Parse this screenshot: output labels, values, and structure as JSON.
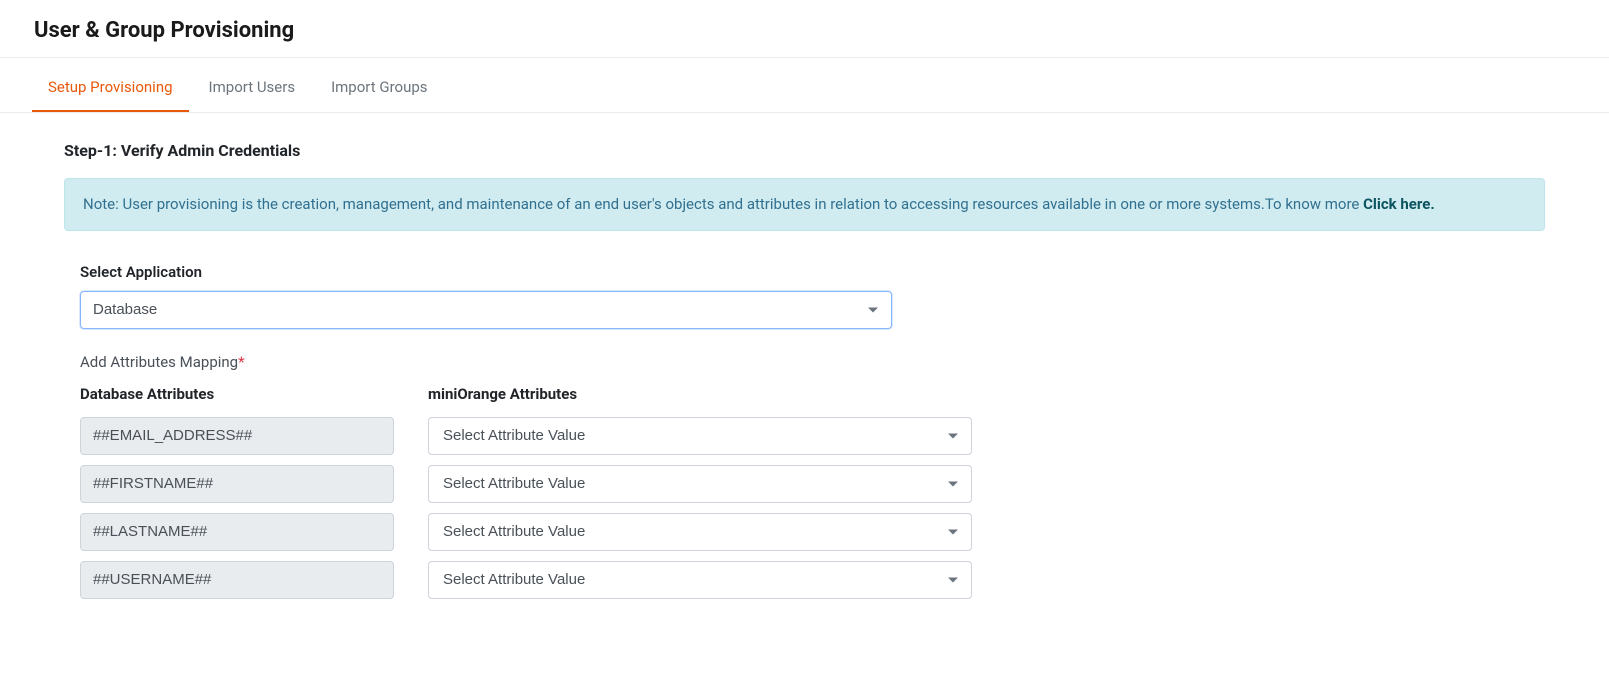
{
  "page_title": "User & Group Provisioning",
  "tabs": {
    "setup": "Setup Provisioning",
    "import_users": "Import Users",
    "import_groups": "Import Groups"
  },
  "step_title": "Step-1: Verify Admin Credentials",
  "note": {
    "prefix": "Note: User provisioning is the creation, management, and maintenance of an end user's objects and attributes in relation to accessing resources available in one or more systems.To know more ",
    "link_text": "Click here."
  },
  "select_application": {
    "label": "Select Application",
    "value": "Database"
  },
  "add_attributes_label": "Add Attributes Mapping",
  "columns": {
    "db_header": "Database Attributes",
    "mo_header": "miniOrange Attributes"
  },
  "mappings": [
    {
      "db": "##EMAIL_ADDRESS##",
      "mo": "Select Attribute Value"
    },
    {
      "db": "##FIRSTNAME##",
      "mo": "Select Attribute Value"
    },
    {
      "db": "##LASTNAME##",
      "mo": "Select Attribute Value"
    },
    {
      "db": "##USERNAME##",
      "mo": "Select Attribute Value"
    }
  ]
}
